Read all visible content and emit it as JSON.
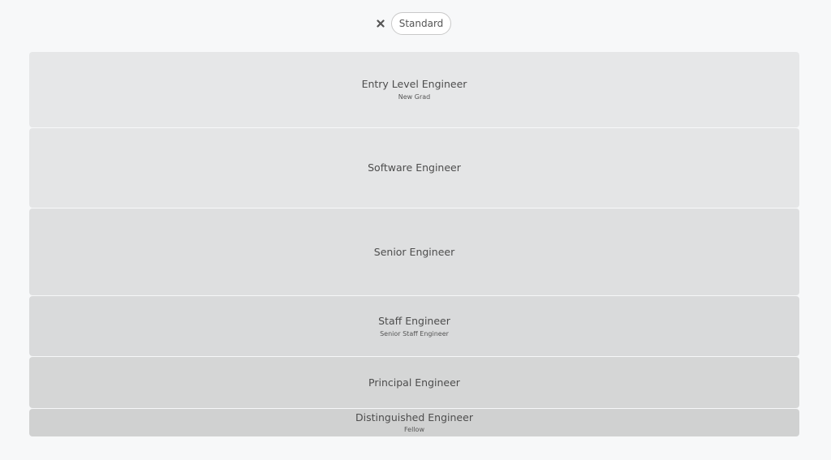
{
  "filter": {
    "clear_icon": "close-x-icon",
    "chip_label": "Standard"
  },
  "levels": [
    {
      "title": "Entry Level Engineer",
      "subtitle": "New Grad",
      "color": "#e6e7e8"
    },
    {
      "title": "Software Engineer",
      "subtitle": "",
      "color": "#e4e5e6"
    },
    {
      "title": "Senior Engineer",
      "subtitle": "",
      "color": "#dedfe0"
    },
    {
      "title": "Staff Engineer",
      "subtitle": "Senior Staff Engineer",
      "color": "#d9dadb"
    },
    {
      "title": "Principal Engineer",
      "subtitle": "",
      "color": "#d5d6d6"
    },
    {
      "title": "Distinguished Engineer",
      "subtitle": "Fellow",
      "color": "#d0d1d1"
    }
  ]
}
